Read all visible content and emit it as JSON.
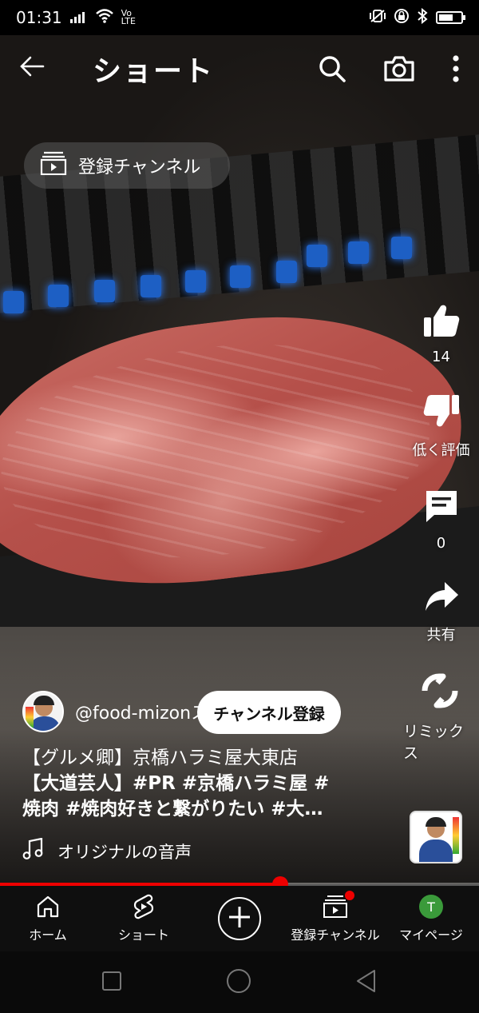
{
  "status_bar": {
    "time": "01:31",
    "network": "Vo LTE"
  },
  "header": {
    "title": "ショート"
  },
  "subscriptions_pill": {
    "label": "登録チャンネル"
  },
  "actions": {
    "like_count": "14",
    "dislike_label": "低く評価",
    "comment_count": "0",
    "share_label": "共有",
    "remix_label": "リミックス"
  },
  "channel": {
    "handle": "@food-mizonス",
    "subscribe_label": "チャンネル登録"
  },
  "description": {
    "line1": "【グルメ卿】京橋ハラミ屋大東店",
    "line2": "【大道芸人】#PR #京橋ハラミ屋 #",
    "line3": "焼肉 #焼肉好きと繋がりたい #大…"
  },
  "sound": {
    "label": "オリジナルの音声"
  },
  "progress": {
    "percent": 58.5
  },
  "bottom_nav": {
    "home": "ホーム",
    "shorts": "ショート",
    "subscriptions": "登録チャンネル",
    "you": "マイページ",
    "you_initial": "T"
  },
  "colors": {
    "accent": "#ff0000",
    "nav_bg": "#0f0f0f",
    "avatar_bg": "#3a9a3a"
  }
}
